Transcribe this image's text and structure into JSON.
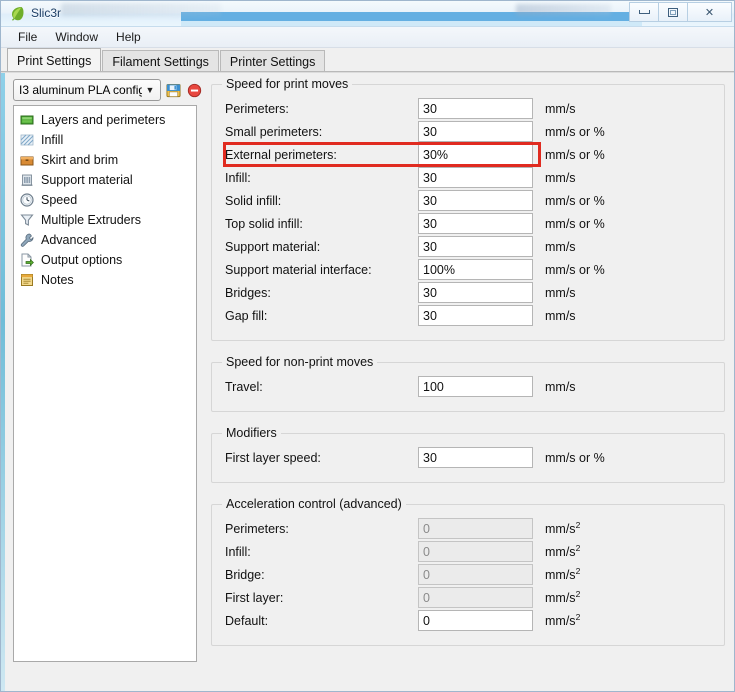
{
  "window": {
    "app_name": "Slic3r",
    "app_icon": "leaf-icon",
    "buttons": {
      "minimize": "minimize",
      "maximize": "restore",
      "close": "✕"
    }
  },
  "menubar": {
    "items": [
      "File",
      "Window",
      "Help"
    ]
  },
  "tabs": [
    {
      "label": "Print Settings",
      "active": true
    },
    {
      "label": "Filament Settings",
      "active": false
    },
    {
      "label": "Printer Settings",
      "active": false
    }
  ],
  "preset": {
    "value": "I3 aluminum PLA config",
    "save_icon": "floppy-save-icon",
    "delete_icon": "delete-circle-icon"
  },
  "sidebar": {
    "items": [
      {
        "label": "Layers and perimeters",
        "icon": "layers-icon"
      },
      {
        "label": "Infill",
        "icon": "infill-hatch-icon"
      },
      {
        "label": "Skirt and brim",
        "icon": "skirt-box-icon"
      },
      {
        "label": "Support material",
        "icon": "support-building-icon"
      },
      {
        "label": "Speed",
        "icon": "clock-icon"
      },
      {
        "label": "Multiple Extruders",
        "icon": "funnel-icon"
      },
      {
        "label": "Advanced",
        "icon": "wrench-icon"
      },
      {
        "label": "Output options",
        "icon": "export-page-icon"
      },
      {
        "label": "Notes",
        "icon": "notes-icon"
      }
    ],
    "selected": "Speed"
  },
  "groups": [
    {
      "title": "Speed for print moves",
      "rows": [
        {
          "label": "Perimeters:",
          "value": "30",
          "unit": "mm/s",
          "disabled": false,
          "highlighted": false
        },
        {
          "label": "Small perimeters:",
          "value": "30",
          "unit": "mm/s or %",
          "disabled": false,
          "highlighted": false
        },
        {
          "label": "External perimeters:",
          "value": "30%",
          "unit": "mm/s or %",
          "disabled": false,
          "highlighted": true
        },
        {
          "label": "Infill:",
          "value": "30",
          "unit": "mm/s",
          "disabled": false,
          "highlighted": false
        },
        {
          "label": "Solid infill:",
          "value": "30",
          "unit": "mm/s or %",
          "disabled": false,
          "highlighted": false
        },
        {
          "label": "Top solid infill:",
          "value": "30",
          "unit": "mm/s or %",
          "disabled": false,
          "highlighted": false
        },
        {
          "label": "Support material:",
          "value": "30",
          "unit": "mm/s",
          "disabled": false,
          "highlighted": false
        },
        {
          "label": "Support material interface:",
          "value": "100%",
          "unit": "mm/s or %",
          "disabled": false,
          "highlighted": false
        },
        {
          "label": "Bridges:",
          "value": "30",
          "unit": "mm/s",
          "disabled": false,
          "highlighted": false
        },
        {
          "label": "Gap fill:",
          "value": "30",
          "unit": "mm/s",
          "disabled": false,
          "highlighted": false
        }
      ]
    },
    {
      "title": "Speed for non-print moves",
      "rows": [
        {
          "label": "Travel:",
          "value": "100",
          "unit": "mm/s",
          "disabled": false,
          "highlighted": false
        }
      ]
    },
    {
      "title": "Modifiers",
      "rows": [
        {
          "label": "First layer speed:",
          "value": "30",
          "unit": "mm/s or %",
          "disabled": false,
          "highlighted": false
        }
      ]
    },
    {
      "title": "Acceleration control (advanced)",
      "rows": [
        {
          "label": "Perimeters:",
          "value": "0",
          "unit": "mm/s²",
          "disabled": true,
          "highlighted": false
        },
        {
          "label": "Infill:",
          "value": "0",
          "unit": "mm/s²",
          "disabled": true,
          "highlighted": false
        },
        {
          "label": "Bridge:",
          "value": "0",
          "unit": "mm/s²",
          "disabled": true,
          "highlighted": false
        },
        {
          "label": "First layer:",
          "value": "0",
          "unit": "mm/s²",
          "disabled": true,
          "highlighted": false
        },
        {
          "label": "Default:",
          "value": "0",
          "unit": "mm/s²",
          "disabled": false,
          "highlighted": false
        }
      ]
    }
  ],
  "colors": {
    "highlight_red": "#e02b20",
    "title_blue": "#4ea3dd",
    "accent_teal": "#6fbdd8"
  }
}
